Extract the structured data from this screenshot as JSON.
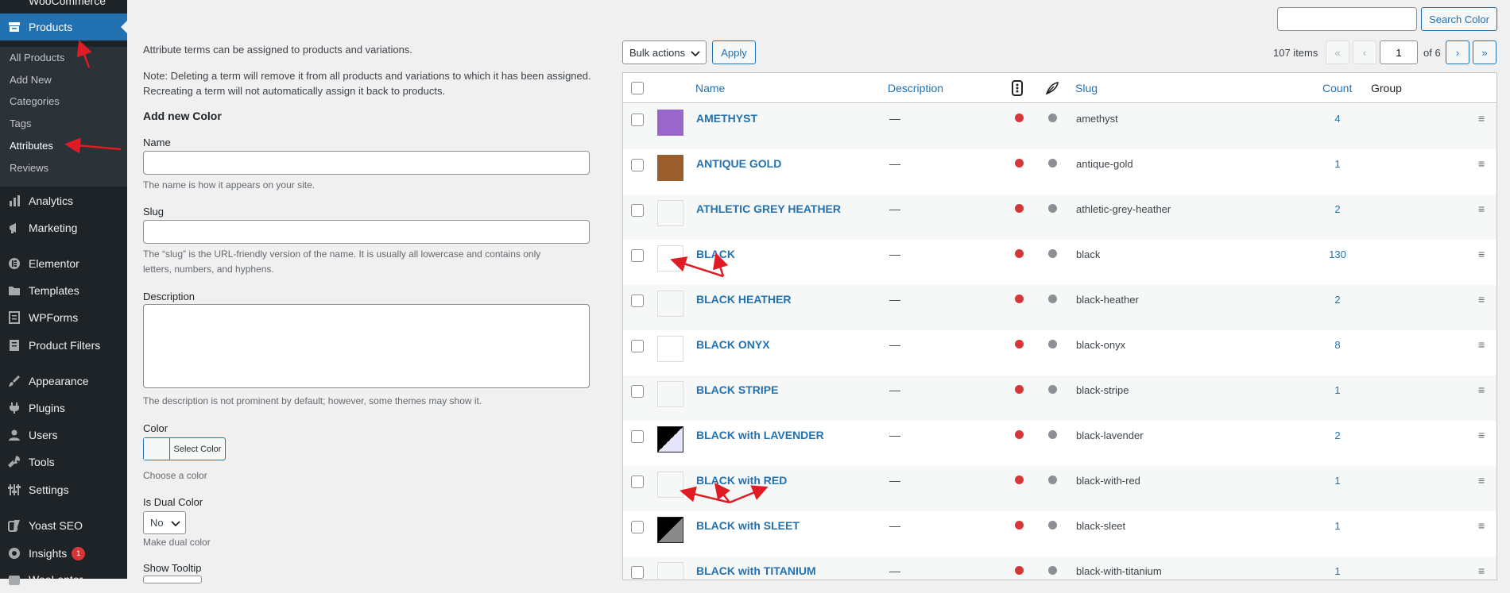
{
  "sidebar": {
    "top_cut": "WooCommerce",
    "products": "Products",
    "submenu": [
      "All Products",
      "Add New",
      "Categories",
      "Tags",
      "Attributes",
      "Reviews"
    ],
    "items": [
      {
        "label": "Analytics",
        "icon": "chart-bar-icon"
      },
      {
        "label": "Marketing",
        "icon": "megaphone-icon"
      },
      {
        "label": "Elementor",
        "icon": "elementor-icon"
      },
      {
        "label": "Templates",
        "icon": "folder-icon"
      },
      {
        "label": "WPForms",
        "icon": "form-icon"
      },
      {
        "label": "Product Filters",
        "icon": "filter-icon"
      },
      {
        "label": "Appearance",
        "icon": "paintbrush-icon"
      },
      {
        "label": "Plugins",
        "icon": "plugin-icon"
      },
      {
        "label": "Users",
        "icon": "user-icon"
      },
      {
        "label": "Tools",
        "icon": "wrench-icon"
      },
      {
        "label": "Settings",
        "icon": "settings-icon"
      },
      {
        "label": "Yoast SEO",
        "icon": "yoast-icon"
      },
      {
        "label": "Insights",
        "icon": "insights-icon",
        "badge": "1"
      },
      {
        "label": "WooLentor",
        "icon": "woolentor-icon"
      }
    ]
  },
  "form": {
    "intro": "Attribute terms can be assigned to products and variations.",
    "note_line1": "Note: Deleting a term will remove it from all products and variations to which it has been assigned.",
    "note_line2": "Recreating a term will not automatically assign it back to products.",
    "heading": "Add new Color",
    "name_label": "Name",
    "name_value": "",
    "name_help": "The name is how it appears on your site.",
    "slug_label": "Slug",
    "slug_value": "",
    "slug_help_line1": "The “slug” is the URL-friendly version of the name. It is usually all lowercase and contains only",
    "slug_help_line2": "letters, numbers, and hyphens.",
    "description_label": "Description",
    "description_value": "",
    "description_help": "The description is not prominent by default; however, some themes may show it.",
    "color_label": "Color",
    "select_color": "Select Color",
    "color_help": "Choose a color",
    "dual_label": "Is Dual Color",
    "dual_value": "No",
    "dual_help": "Make dual color",
    "tooltip_label": "Show Tooltip"
  },
  "toolbar": {
    "search_value": "",
    "search_button": "Search Color",
    "bulk_actions": "Bulk actions",
    "apply": "Apply",
    "items_count": "107 items",
    "first": "«",
    "prev": "‹",
    "page": "1",
    "of_pages": "of 6",
    "next": "›",
    "last": "»"
  },
  "table": {
    "headers": {
      "name": "Name",
      "description": "Description",
      "slug": "Slug",
      "count": "Count",
      "group": "Group"
    },
    "rows": [
      {
        "name": "AMETHYST",
        "description": "—",
        "slug": "amethyst",
        "count": "4",
        "swatch": "#9966cc",
        "swatch2": ""
      },
      {
        "name": "ANTIQUE GOLD",
        "description": "—",
        "slug": "antique-gold",
        "count": "1",
        "swatch": "#9b5f2e",
        "swatch2": ""
      },
      {
        "name": "ATHLETIC GREY HEATHER",
        "description": "—",
        "slug": "athletic-grey-heather",
        "count": "2",
        "swatch": "#f6f7f7",
        "swatch2": ""
      },
      {
        "name": "BLACK",
        "description": "—",
        "slug": "black",
        "count": "130",
        "swatch": "#ffffff",
        "swatch2": ""
      },
      {
        "name": "BLACK HEATHER",
        "description": "—",
        "slug": "black-heather",
        "count": "2",
        "swatch": "#f6f7f7",
        "swatch2": ""
      },
      {
        "name": "BLACK ONYX",
        "description": "—",
        "slug": "black-onyx",
        "count": "8",
        "swatch": "#ffffff",
        "swatch2": ""
      },
      {
        "name": "BLACK STRIPE",
        "description": "—",
        "slug": "black-stripe",
        "count": "1",
        "swatch": "#f6f7f7",
        "swatch2": ""
      },
      {
        "name": "BLACK with LAVENDER",
        "description": "—",
        "slug": "black-lavender",
        "count": "2",
        "swatch": "#000000",
        "swatch2": "#e6e6fa"
      },
      {
        "name": "BLACK with RED",
        "description": "—",
        "slug": "black-with-red",
        "count": "1",
        "swatch": "#f6f7f7",
        "swatch2": ""
      },
      {
        "name": "BLACK with SLEET",
        "description": "—",
        "slug": "black-sleet",
        "count": "1",
        "swatch": "#000000",
        "swatch2": "#8a8a8a"
      },
      {
        "name": "BLACK with TITANIUM",
        "description": "—",
        "slug": "black-with-titanium",
        "count": "1",
        "swatch": "#f6f7f7",
        "swatch2": ""
      }
    ]
  },
  "colors": {
    "accent": "#2271b1",
    "sidebar": "#1d2327",
    "red_dot": "#d63638",
    "grey_dot": "#8c8f94",
    "annotation": "#e01b24"
  }
}
